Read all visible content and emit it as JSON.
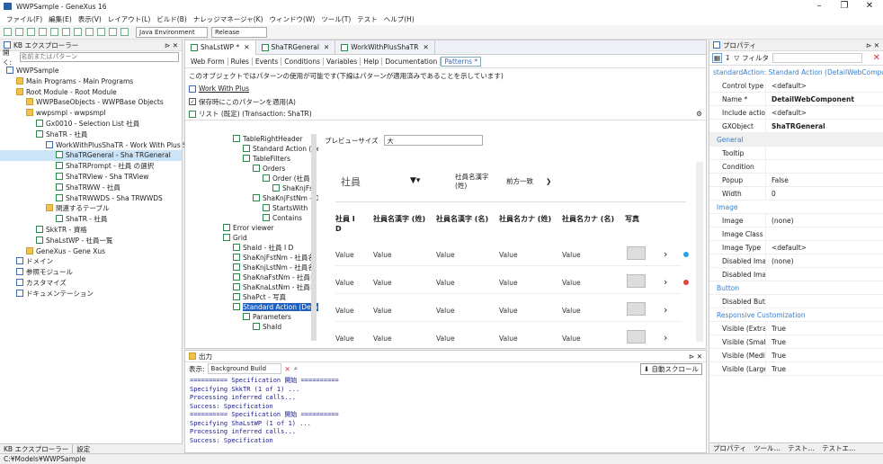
{
  "window": {
    "title": "WWPSample - GeneXus 16",
    "minimize": "–",
    "maximize": "❐",
    "close": "✕"
  },
  "menu": [
    "ファイル(F)",
    "編集(E)",
    "表示(V)",
    "レイアウト(L)",
    "ビルド(B)",
    "ナレッジマネージャ(K)",
    "ウィンドウ(W)",
    "ツール(T)",
    "テスト",
    "ヘルプ(H)"
  ],
  "toolbar": {
    "environment": "Java Environment",
    "configuration": "Release"
  },
  "kb": {
    "title": "KB エクスプローラー",
    "search_label": "開く:",
    "search_placeholder": "名前またはパターン",
    "tree": [
      {
        "label": "WWPSample",
        "indent": 1,
        "icon": "kb"
      },
      {
        "label": "Main Programs - Main Programs",
        "indent": 2,
        "icon": "f"
      },
      {
        "label": "Root Module - Root Module",
        "indent": 2,
        "icon": "f"
      },
      {
        "label": "WWPBaseObjects - WWPBase Objects",
        "indent": 3,
        "icon": "f"
      },
      {
        "label": "wwpsmpl - wwpsmpl",
        "indent": 3,
        "icon": "f"
      },
      {
        "label": "Gx0010 - Selection List 社員",
        "indent": 4,
        "icon": "g"
      },
      {
        "label": "ShaTR - 社員",
        "indent": 4,
        "icon": "t"
      },
      {
        "label": "WorkWithPlusShaTR - Work With Plus S",
        "indent": 5,
        "icon": "b"
      },
      {
        "label": "ShaTRGeneral - Sha TRGeneral",
        "indent": 6,
        "icon": "g",
        "selected": true
      },
      {
        "label": "ShaTRPrompt - 社員 の選択",
        "indent": 6,
        "icon": "g"
      },
      {
        "label": "ShaTRView - Sha TRView",
        "indent": 6,
        "icon": "g"
      },
      {
        "label": "ShaTRWW - 社員",
        "indent": 6,
        "icon": "g"
      },
      {
        "label": "ShaTRWWDS - Sha TRWWDS",
        "indent": 6,
        "icon": "g"
      },
      {
        "label": "関連するテーブル",
        "indent": 5,
        "icon": "f"
      },
      {
        "label": "ShaTR - 社員",
        "indent": 6,
        "icon": "t"
      },
      {
        "label": "SkkTR - 資格",
        "indent": 4,
        "icon": "t"
      },
      {
        "label": "ShaLstWP - 社員一覧",
        "indent": 4,
        "icon": "g"
      },
      {
        "label": "GeneXus - Gene Xus",
        "indent": 3,
        "icon": "f"
      },
      {
        "label": "ドメイン",
        "indent": 2,
        "icon": "b"
      },
      {
        "label": "参照モジュール",
        "indent": 2,
        "icon": "b"
      },
      {
        "label": "カスタマイズ",
        "indent": 2,
        "icon": "b"
      },
      {
        "label": "ドキュメンテーション",
        "indent": 2,
        "icon": "b"
      }
    ],
    "bottom_tabs": [
      "KB エクスプローラー",
      "設定"
    ]
  },
  "editor": {
    "tabs": [
      "ShaLstWP *",
      "ShaTRGeneral",
      "WorkWithPlusShaTR"
    ],
    "subtabs": [
      "Web Form",
      "Rules",
      "Events",
      "Conditions",
      "Variables",
      "Help",
      "Documentation",
      "Patterns *"
    ],
    "info": "このオブジェクトではパターンの使用が可能です(下線はパターンが適用済みであることを示しています)",
    "pattern_link": "Work With Plus",
    "apply_on_save": "保存時にこのパターンを適用(A)",
    "instance_label": "リスト (既定) (Transaction: ShaTR)",
    "tree": [
      {
        "label": "TableRightHeader",
        "indent": 2
      },
      {
        "label": "Standard Action (New)",
        "indent": 3
      },
      {
        "label": "TableFilters",
        "indent": 3
      },
      {
        "label": "Orders",
        "indent": 4
      },
      {
        "label": "Order (社員",
        "indent": 5
      },
      {
        "label": "ShaKnjFst",
        "indent": 6
      },
      {
        "label": "ShaKnjFstNm - D",
        "indent": 4
      },
      {
        "label": "StartsWith",
        "indent": 5
      },
      {
        "label": "Contains",
        "indent": 5
      },
      {
        "label": "Error viewer",
        "indent": 1
      },
      {
        "label": "Grid",
        "indent": 1
      },
      {
        "label": "ShaId - 社員 I D",
        "indent": 2
      },
      {
        "label": "ShaKnjFstNm - 社員名",
        "indent": 2
      },
      {
        "label": "ShaKnjLstNm - 社員名",
        "indent": 2
      },
      {
        "label": "ShaKnaFstNm - 社員名",
        "indent": 2
      },
      {
        "label": "ShaKnaLstNm - 社員名",
        "indent": 2
      },
      {
        "label": "ShaPct - 写真",
        "indent": 2
      },
      {
        "label": "Standard Action (Detail",
        "indent": 2,
        "selected": true
      },
      {
        "label": "Parameters",
        "indent": 3
      },
      {
        "label": "ShaId",
        "indent": 4
      }
    ],
    "preview": {
      "size_label": "プレビューサイズ",
      "size_value": "大",
      "title": "社員",
      "filter_label": "社員名漢字 (姓)",
      "filter_op": "前方一致",
      "columns": [
        "社員 I D",
        "社員名漢字 (姓)",
        "社員名漢字 (名)",
        "社員名カナ (姓)",
        "社員名カナ (名)",
        "写真"
      ],
      "rows": [
        [
          "Value",
          "Value",
          "Value",
          "Value",
          "Value"
        ],
        [
          "Value",
          "Value",
          "Value",
          "Value",
          "Value"
        ],
        [
          "Value",
          "Value",
          "Value",
          "Value",
          "Value"
        ],
        [
          "Value",
          "Value",
          "Value",
          "Value",
          "Value"
        ]
      ],
      "dots": [
        "#2aa4e0",
        "#e0453a"
      ]
    }
  },
  "output": {
    "title": "出力",
    "show_label": "表示:",
    "source": "Background Build",
    "autoscroll": "自動スクロール",
    "lines": [
      "========== Specification 開始 ==========",
      "Specifying SkkTR (1 of 1) ...",
      "Processing inferred calls...",
      "Success: Specification",
      "========== Specification 開始 ==========",
      "Specifying ShaLstWP (1 of 1) ...",
      "Processing inferred calls...",
      "Success: Specification"
    ]
  },
  "props": {
    "title": "プロパティ",
    "filter": "フィルタ",
    "section": "standardAction: Standard Action (DetailWebCompo...",
    "rows": [
      {
        "k": "Control type",
        "v": "<default>"
      },
      {
        "k": "Name *",
        "v": "DetailWebComponent",
        "bold": true
      },
      {
        "k": "Include action",
        "v": "<default>"
      },
      {
        "k": "GXObject",
        "v": "ShaTRGeneral",
        "bold": true
      },
      {
        "group": "General"
      },
      {
        "k": "Tooltip",
        "v": ""
      },
      {
        "k": "Condition",
        "v": ""
      },
      {
        "k": "Popup",
        "v": "False"
      },
      {
        "k": "Width",
        "v": "0"
      },
      {
        "group": "Image"
      },
      {
        "k": "Image",
        "v": "(none)"
      },
      {
        "k": "Image Class",
        "v": ""
      },
      {
        "k": "Image Type",
        "v": "<default>"
      },
      {
        "k": "Disabled Image",
        "v": "(none)"
      },
      {
        "k": "Disabled Image Cl",
        "v": ""
      },
      {
        "group": "Button"
      },
      {
        "k": "Disabled Button C",
        "v": ""
      },
      {
        "group": "Responsive Customization"
      },
      {
        "k": "Visible (Extra Sma",
        "v": "True"
      },
      {
        "k": "Visible (Small)",
        "v": "True"
      },
      {
        "k": "Visible (Medium)",
        "v": "True"
      },
      {
        "k": "Visible (Large)",
        "v": "True"
      }
    ],
    "bottom_tabs": [
      "プロパティ",
      "ツール…",
      "テスト…",
      "テストエ…"
    ]
  },
  "status": "C:¥Models¥WWPSample"
}
